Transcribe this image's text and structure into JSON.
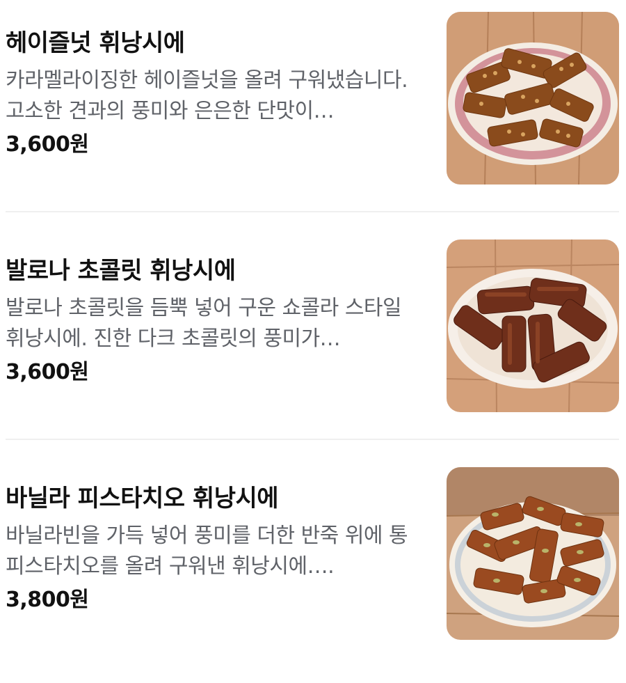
{
  "menu": {
    "items": [
      {
        "name": "헤이즐넛 휘낭시에",
        "description": "카라멜라이징한 헤이즐넛을 올려 구워냈습니다. 고소한 견과의 풍미와 은은한 단맛이…",
        "price": "3,600원",
        "image_icon": "hazelnut-financier-photo"
      },
      {
        "name": "발로나 초콜릿 휘낭시에",
        "description": "발로나 초콜릿을 듬뿍 넣어 구운 쇼콜라 스타일 휘낭시에. 진한 다크 초콜릿의 풍미가…",
        "price": "3,600원",
        "image_icon": "chocolate-financier-photo"
      },
      {
        "name": "바닐라 피스타치오 휘낭시에",
        "description": "바닐라빈을 가득 넣어 풍미를 더한 반죽 위에 통피스타치오를 올려 구워낸 휘낭시에….",
        "price": "3,800원",
        "image_icon": "pistachio-financier-photo"
      }
    ]
  },
  "colors": {
    "title": "#111111",
    "description": "#5f6268",
    "price": "#111111",
    "divider": "#efefef",
    "wood": "#c8926a"
  }
}
